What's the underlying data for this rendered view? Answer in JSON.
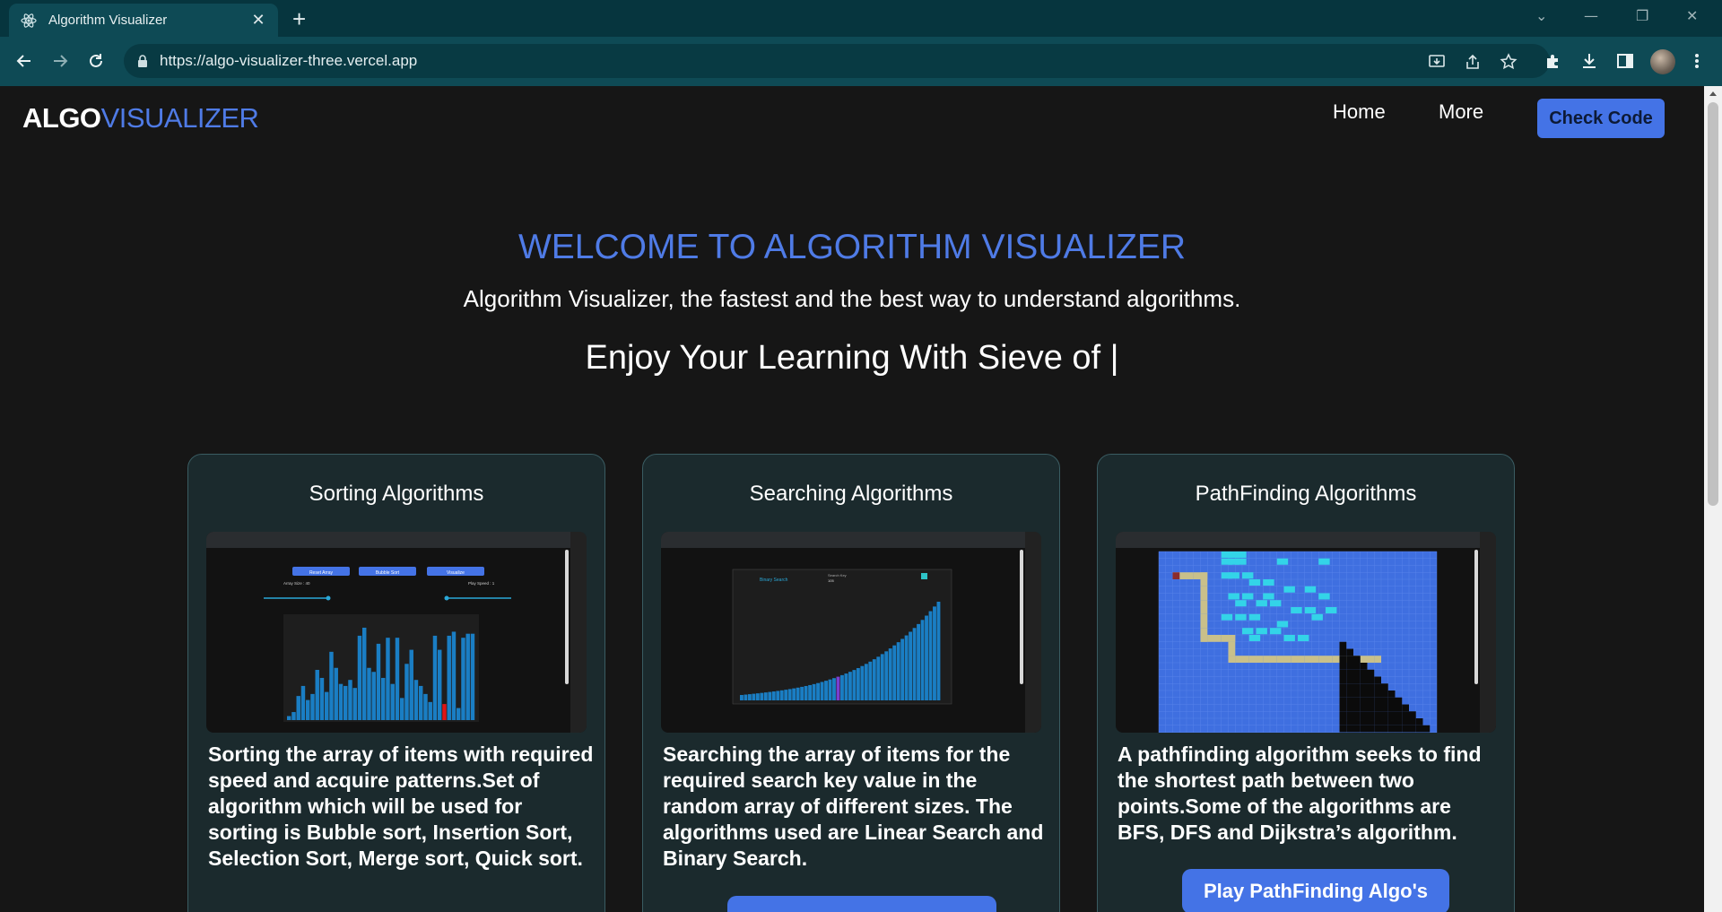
{
  "browser": {
    "tab_title": "Algorithm Visualizer",
    "url": "https://algo-visualizer-three.vercel.app",
    "new_tab_label": "+"
  },
  "header": {
    "brand_part1": "ALGO",
    "brand_part2": "VISUALIZER",
    "nav_home": "Home",
    "nav_more": "More",
    "check_code": "Check Code"
  },
  "hero": {
    "title": "WELCOME TO ALGORITHM VISUALIZER",
    "subtitle": "Algorithm Visualizer, the fastest and the best way to understand algorithms.",
    "typed_prefix": "Enjoy Your Learning With",
    "typed_text": "Sieve of |"
  },
  "cards": [
    {
      "title": "Sorting Algorithms",
      "description": "Sorting the array of items with required speed and acquire patterns.Set of algorithm which will be used for sorting is Bubble sort, Insertion Sort, Selection Sort, Merge sort, Quick sort.",
      "button": "",
      "preview": {
        "buttons": [
          "Reset Array",
          "Bubble Sort",
          "Visualize"
        ],
        "array_size": "Array Size : 40",
        "play_speed": "Play Speed : 1",
        "bars": [
          4,
          8,
          24,
          34,
          20,
          26,
          50,
          42,
          28,
          68,
          52,
          36,
          34,
          40,
          32,
          84,
          92,
          52,
          48,
          76,
          42,
          82,
          36,
          82,
          22,
          56,
          70,
          40,
          34,
          26,
          18,
          84,
          70,
          16,
          84,
          88,
          12,
          82,
          86,
          86
        ],
        "highlight_index": 33
      }
    },
    {
      "title": "Searching Algorithms",
      "description": "Searching the array of items for the required search key value in the random array of different sizes. The algorithms used are Linear Search and Binary Search.",
      "button": "",
      "preview": {
        "label": "Binary Search",
        "key_label": "Search Key",
        "key_value": "105",
        "bar_count": 50,
        "highlight_index": 24
      }
    },
    {
      "title": "PathFinding Algorithms",
      "description": "A pathfinding algorithm seeks to find the shortest path between two points.Some of the algorithms are BFS, DFS and Dijkstra’s algorithm.",
      "button": "Play PathFinding Algo's",
      "preview": {}
    }
  ],
  "colors": {
    "accent": "#4f7be6",
    "button": "#4473e6",
    "chrome": "#0e4a55",
    "card_bg": "#1b2a2d",
    "bar": "#1a7ec4",
    "bar_highlight": "#e01515",
    "grid": "#3f6fe0"
  }
}
